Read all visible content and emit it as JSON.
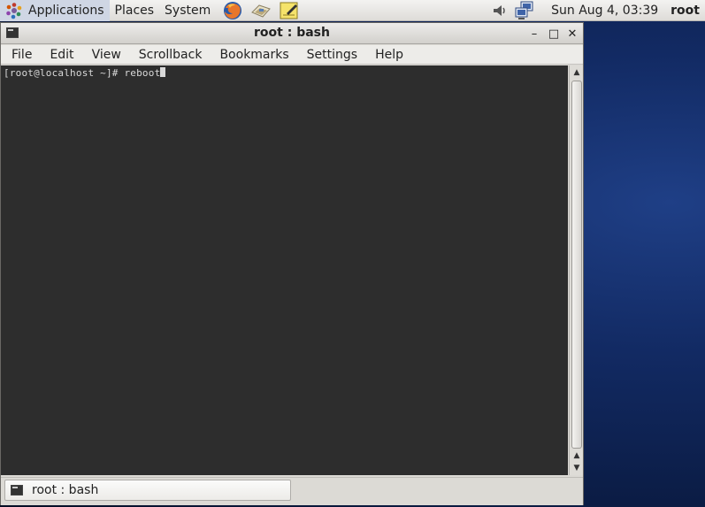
{
  "top_panel": {
    "menus": [
      "Applications",
      "Places",
      "System"
    ],
    "launchers": [
      "firefox-icon",
      "email-icon",
      "notes-icon"
    ],
    "tray": [
      "volume-icon",
      "network-icon"
    ],
    "clock": "Sun Aug  4, 03:39",
    "user": "root"
  },
  "window": {
    "title": "root : bash",
    "controls": {
      "minimize": "–",
      "maximize": "□",
      "close": "✕"
    },
    "menubar": [
      "File",
      "Edit",
      "View",
      "Scrollback",
      "Bookmarks",
      "Settings",
      "Help"
    ],
    "terminal": {
      "prompt": "[root@localhost ~]# ",
      "command": "reboot"
    }
  },
  "taskbar": {
    "task_label": "root : bash"
  },
  "colors": {
    "terminal_bg": "#2d2d2d",
    "terminal_fg": "#d9d9d9",
    "desktop_bg": "#122a63"
  }
}
